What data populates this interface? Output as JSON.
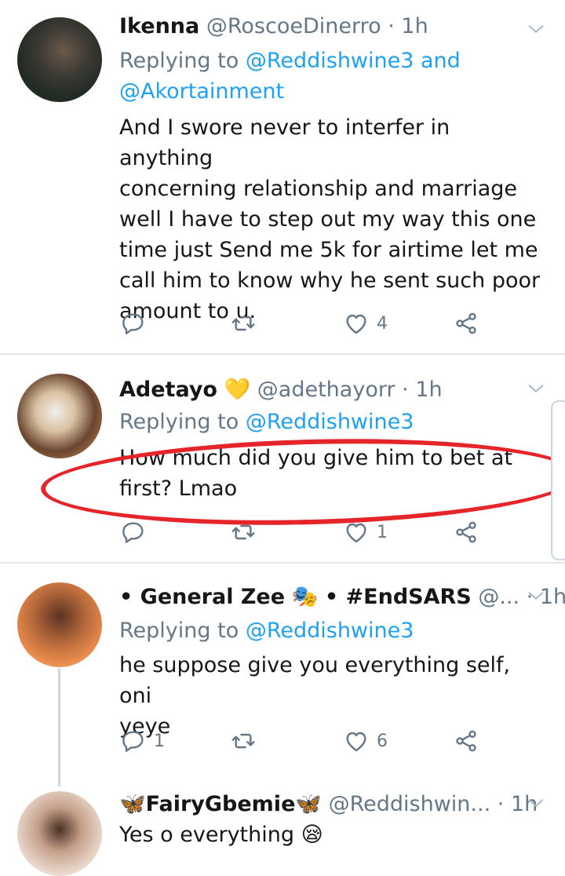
{
  "tweets": [
    {
      "name": "Ikenna",
      "handle": "@RoscoeDinerro",
      "time": "1h",
      "replying_prefix": "Replying to",
      "replying_to": "@Reddishwine3 and",
      "replying_to_2": "@Akortainment",
      "text_lines": [
        "And I swore never to interfer in anything",
        "concerning relationship and marriage",
        "well I have to step out my way this one",
        "time just Send me 5k for airtime let me",
        "call him to know why he sent such poor",
        "amount to u."
      ],
      "reply_count": "",
      "retweet_count": "",
      "like_count": "4"
    },
    {
      "name": "Adetayo",
      "name_emoji": "💛",
      "handle": "@adethayorr",
      "time": "1h",
      "replying_prefix": "Replying to",
      "replying_to": "@Reddishwine3",
      "text_lines": [
        "How much did you give him to bet at",
        "first? Lmao"
      ],
      "reply_count": "",
      "retweet_count": "",
      "like_count": "1"
    },
    {
      "name": "• General Zee",
      "name_emoji": "🎭",
      "name_suffix": "• #EndSARS",
      "handle": "@...",
      "time": "1h",
      "replying_prefix": "Replying to",
      "replying_to": "@Reddishwine3",
      "text_lines": [
        "he suppose give you everything self, oni",
        "yeye"
      ],
      "reply_count": "1",
      "retweet_count": "",
      "like_count": "6"
    },
    {
      "name": "FairyGbemie",
      "name_prefix_emoji": "🦋",
      "name_suffix_emoji": "🦋",
      "handle": "@Reddishwin...",
      "time": "1h",
      "text": "Yes o everything",
      "text_emoji": "😪"
    }
  ],
  "dot": "·",
  "icons": {
    "reply": "reply-icon",
    "retweet": "retweet-icon",
    "like": "like-icon",
    "share": "share-icon",
    "caret": "chevron-down-icon"
  },
  "colors": {
    "link": "#1da1f2",
    "muted": "#657786",
    "highlight": "#e5252a"
  }
}
